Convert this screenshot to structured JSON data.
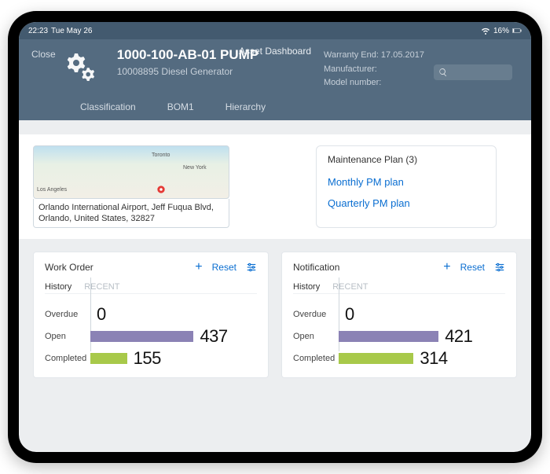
{
  "statusbar": {
    "time": "22:23",
    "date": "Tue May 26",
    "battery": "16%"
  },
  "header": {
    "close": "Close",
    "dashboard_label": "Asset Dashboard",
    "asset_title": "1000-100-AB-01 PUMP",
    "asset_sub": "10008895 Diesel Generator",
    "meta": {
      "warranty": "Warranty End: 17.05.2017",
      "manufacturer": "Manufacturer:",
      "model": "Model number:"
    },
    "tabs": [
      "Classification",
      "BOM1",
      "Hierarchy"
    ]
  },
  "map": {
    "address": "Orlando International Airport, Jeff Fuqua Blvd, Orlando, United States, 32827",
    "cities": {
      "toronto": "Toronto",
      "newyork": "New York",
      "la": "Los Angeles"
    }
  },
  "maintenance": {
    "heading": "Maintenance Plan (3)",
    "items": [
      "Monthly PM plan",
      "Quarterly PM plan"
    ]
  },
  "cards": {
    "work_order": {
      "title": "Work Order",
      "reset": "Reset",
      "subtabs": {
        "a": "History",
        "b": "RECENT"
      }
    },
    "notification": {
      "title": "Notification",
      "reset": "Reset",
      "subtabs": {
        "a": "History",
        "b": "RECENT"
      }
    },
    "row_labels": {
      "overdue": "Overdue",
      "open": "Open",
      "completed": "Completed"
    }
  },
  "chart_data": [
    {
      "type": "bar",
      "title": "Work Order",
      "orientation": "horizontal",
      "categories": [
        "Overdue",
        "Open",
        "Completed"
      ],
      "values": [
        0,
        437,
        155
      ],
      "colors": [
        "#8b82b5",
        "#8b82b5",
        "#a8c94a"
      ],
      "xlim": [
        0,
        500
      ]
    },
    {
      "type": "bar",
      "title": "Notification",
      "orientation": "horizontal",
      "categories": [
        "Overdue",
        "Open",
        "Completed"
      ],
      "values": [
        0,
        421,
        314
      ],
      "colors": [
        "#8b82b5",
        "#8b82b5",
        "#a8c94a"
      ],
      "xlim": [
        0,
        500
      ]
    }
  ]
}
